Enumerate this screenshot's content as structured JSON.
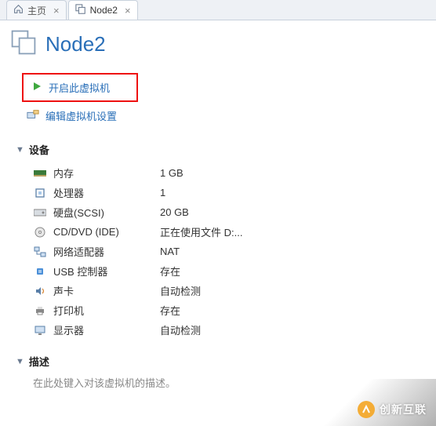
{
  "tabs": {
    "home": "主页",
    "node": "Node2"
  },
  "title": "Node2",
  "actions": {
    "power_on": "开启此虚拟机",
    "edit_settings": "编辑虚拟机设置"
  },
  "sections": {
    "devices": "设备",
    "description": "描述"
  },
  "devices": [
    {
      "label": "内存",
      "value": "1 GB",
      "icon": "memory"
    },
    {
      "label": "处理器",
      "value": "1",
      "icon": "cpu"
    },
    {
      "label": "硬盘(SCSI)",
      "value": "20 GB",
      "icon": "disk"
    },
    {
      "label": "CD/DVD (IDE)",
      "value": "正在使用文件 D:...",
      "icon": "cd"
    },
    {
      "label": "网络适配器",
      "value": "NAT",
      "icon": "network"
    },
    {
      "label": "USB 控制器",
      "value": "存在",
      "icon": "usb"
    },
    {
      "label": "声卡",
      "value": "自动检测",
      "icon": "sound"
    },
    {
      "label": "打印机",
      "value": "存在",
      "icon": "printer"
    },
    {
      "label": "显示器",
      "value": "自动检测",
      "icon": "display"
    }
  ],
  "description_placeholder": "在此处键入对该虚拟机的描述。",
  "watermark": "创新互联"
}
